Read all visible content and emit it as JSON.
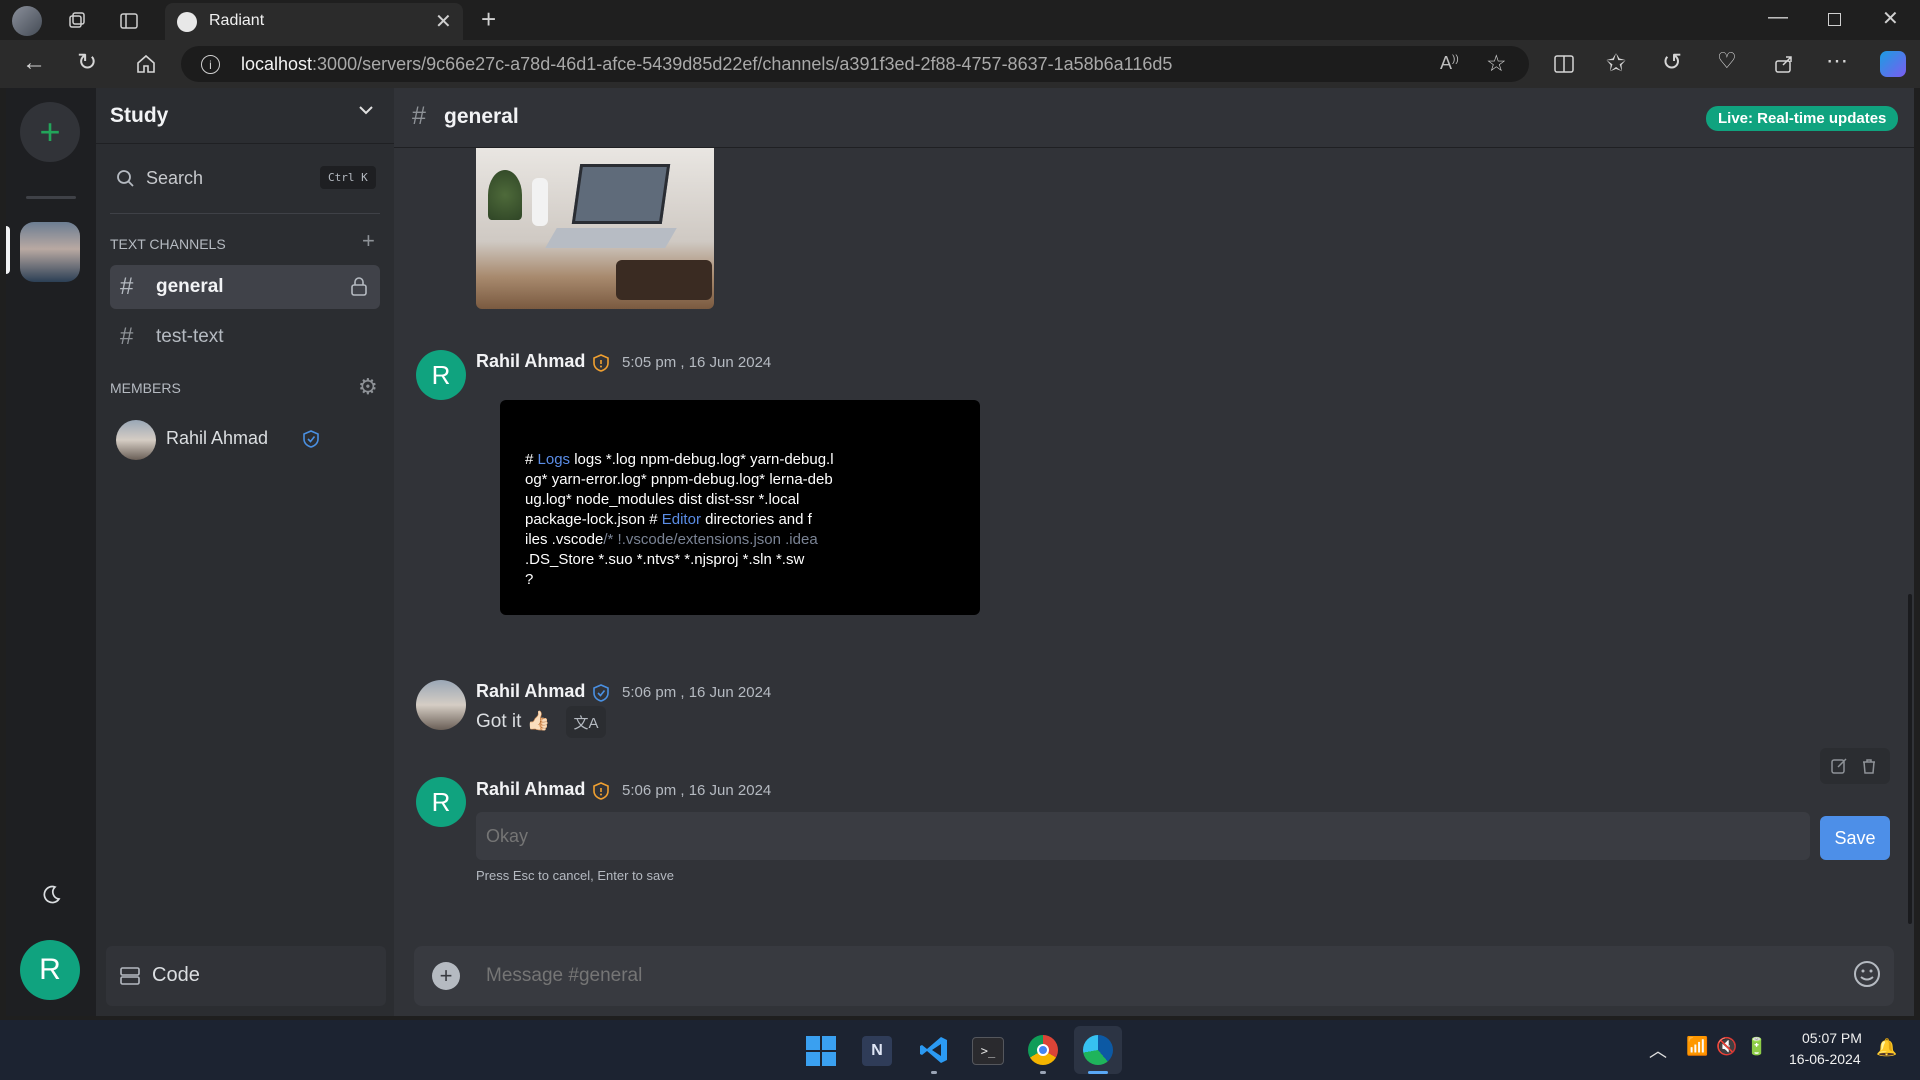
{
  "browser": {
    "tab_title": "Radiant",
    "url_host": "localhost",
    "url_path": ":3000/servers/9c66e27c-a78d-46d1-afce-5439d85d22ef/channels/a391f3ed-2f88-4757-8637-1a58b6a116d5"
  },
  "server": {
    "name": "Study",
    "search_label": "Search",
    "search_shortcut": "Ctrl K",
    "text_channels_heading": "TEXT CHANNELS",
    "channels": [
      {
        "name": "general",
        "active": true,
        "locked": true
      },
      {
        "name": "test-text",
        "active": false,
        "locked": false
      }
    ],
    "members_heading": "MEMBERS",
    "members": [
      {
        "name": "Rahil Ahmad",
        "verified": true
      }
    ],
    "footer_label": "Code"
  },
  "user": {
    "avatar_letter": "R"
  },
  "channel": {
    "name": "general",
    "live_badge": "Live: Real-time updates",
    "composer_placeholder": "Message #general"
  },
  "messages": [
    {
      "author": "Rahil Ahmad",
      "time": "5:05 pm , 16 Jun 2024",
      "avatar_letter": "R",
      "file_lines": [
        [
          "# ",
          "Logs",
          " logs *.log npm-debug.log* yarn-debug.l"
        ],
        [
          "og* yarn-error.log* pnpm-debug.log* lerna-deb"
        ],
        [
          "ug.log* node_modules dist dist-ssr *.local"
        ],
        [
          "package-lock.json # ",
          "Editor",
          " directories and f"
        ],
        [
          "iles .vscode",
          "/* !.vscode/extensions.json .idea"
        ],
        [
          ".DS_Store *.suo *.ntvs* *.njsproj *.sln *.sw"
        ],
        [
          "?"
        ]
      ]
    },
    {
      "author": "Rahil Ahmad",
      "time": "5:06 pm , 16 Jun 2024",
      "text": "Got it 👍🏻"
    },
    {
      "author": "Rahil Ahmad",
      "time": "5:06 pm , 16 Jun 2024",
      "avatar_letter": "R",
      "edit_value": "Okay",
      "save_label": "Save",
      "edit_hint": "Press Esc to cancel, Enter to save"
    }
  ],
  "taskbar": {
    "time": "05:07 PM",
    "date": "16-06-2024"
  },
  "colors": {
    "accent_green": "#10a37f",
    "save_blue": "#4d8fe8",
    "link_blue": "#5b8de6",
    "role_orange": "#f0a030",
    "verified_blue": "#4a90e2"
  }
}
